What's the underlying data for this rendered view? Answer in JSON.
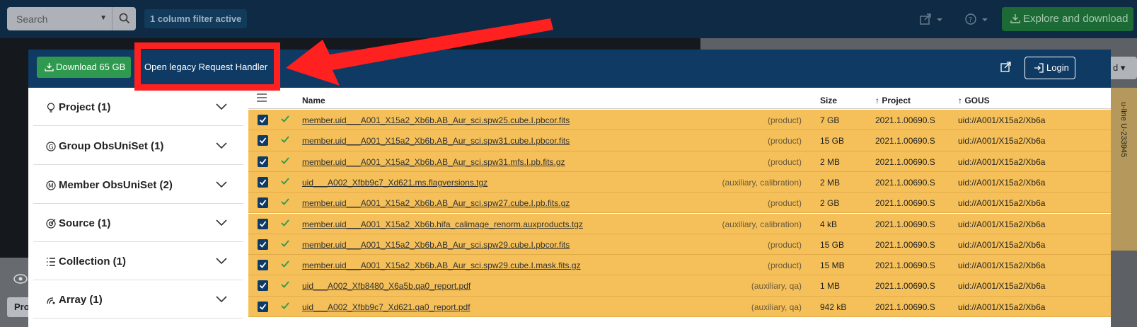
{
  "topbar": {
    "search_placeholder": "Search",
    "filter_badge": "1 column filter active",
    "explore_label": "Explore and download"
  },
  "background": {
    "strip_text": "u-line U-233945",
    "bottom_label": "Pro"
  },
  "modal": {
    "download_label": "Download 65 GB",
    "legacy_label": "Open legacy Request Handler",
    "login_label": "Login"
  },
  "facets": [
    {
      "label": "Project (1)",
      "icon": "bulb-icon"
    },
    {
      "label": "Group ObsUniSet (1)",
      "icon": "g-circle-icon"
    },
    {
      "label": "Member ObsUniSet (2)",
      "icon": "m-circle-icon"
    },
    {
      "label": "Source (1)",
      "icon": "target-icon"
    },
    {
      "label": "Collection (1)",
      "icon": "list-icon"
    },
    {
      "label": "Array (1)",
      "icon": "antenna-icon"
    }
  ],
  "table": {
    "headers": {
      "name": "Name",
      "size": "Size",
      "project": "Project",
      "gous": "GOUS"
    },
    "rows": [
      {
        "name": "member.uid___A001_X15a2_Xb6b.AB_Aur_sci.spw25.cube.I.pbcor.fits",
        "type": "(product)",
        "size": "7 GB",
        "project": "2021.1.00690.S",
        "gous": "uid://A001/X15a2/Xb6a"
      },
      {
        "name": "member.uid___A001_X15a2_Xb6b.AB_Aur_sci.spw31.cube.I.pbcor.fits",
        "type": "(product)",
        "size": "15 GB",
        "project": "2021.1.00690.S",
        "gous": "uid://A001/X15a2/Xb6a"
      },
      {
        "name": "member.uid___A001_X15a2_Xb6b.AB_Aur_sci.spw31.mfs.I.pb.fits.gz",
        "type": "(product)",
        "size": "2 MB",
        "project": "2021.1.00690.S",
        "gous": "uid://A001/X15a2/Xb6a"
      },
      {
        "name": "uid___A002_Xfbb9c7_Xd621.ms.flagversions.tgz",
        "type": "(auxiliary, calibration)",
        "size": "2 MB",
        "project": "2021.1.00690.S",
        "gous": "uid://A001/X15a2/Xb6a"
      },
      {
        "name": "member.uid___A001_X15a2_Xb6b.AB_Aur_sci.spw27.cube.I.pb.fits.gz",
        "type": "(product)",
        "size": "2 GB",
        "project": "2021.1.00690.S",
        "gous": "uid://A001/X15a2/Xb6a"
      },
      {
        "name": "member.uid___A001_X15a2_Xb6b.hifa_calimage_renorm.auxproducts.tgz",
        "type": "(auxiliary, calibration)",
        "size": "4 kB",
        "project": "2021.1.00690.S",
        "gous": "uid://A001/X15a2/Xb6a"
      },
      {
        "name": "member.uid___A001_X15a2_Xb6b.AB_Aur_sci.spw29.cube.I.pbcor.fits",
        "type": "(product)",
        "size": "15 GB",
        "project": "2021.1.00690.S",
        "gous": "uid://A001/X15a2/Xb6a"
      },
      {
        "name": "member.uid___A001_X15a2_Xb6b.AB_Aur_sci.spw29.cube.I.mask.fits.gz",
        "type": "(product)",
        "size": "15 MB",
        "project": "2021.1.00690.S",
        "gous": "uid://A001/X15a2/Xb6a"
      },
      {
        "name": "uid___A002_Xfb8480_X6a5b.qa0_report.pdf",
        "type": "(auxiliary, qa)",
        "size": "1 MB",
        "project": "2021.1.00690.S",
        "gous": "uid://A001/X15a2/Xb6a"
      },
      {
        "name": "uid___A002_Xfbb9c7_Xd621.qa0_report.pdf",
        "type": "(auxiliary, qa)",
        "size": "942 kB",
        "project": "2021.1.00690.S",
        "gous": "uid://A001/X15a2/Xb6a"
      }
    ]
  },
  "colors": {
    "row_selected": "#f5c059",
    "header_bg": "#0f3a64",
    "download_green": "#2f9a4f",
    "annotation_red": "#ff2020"
  }
}
